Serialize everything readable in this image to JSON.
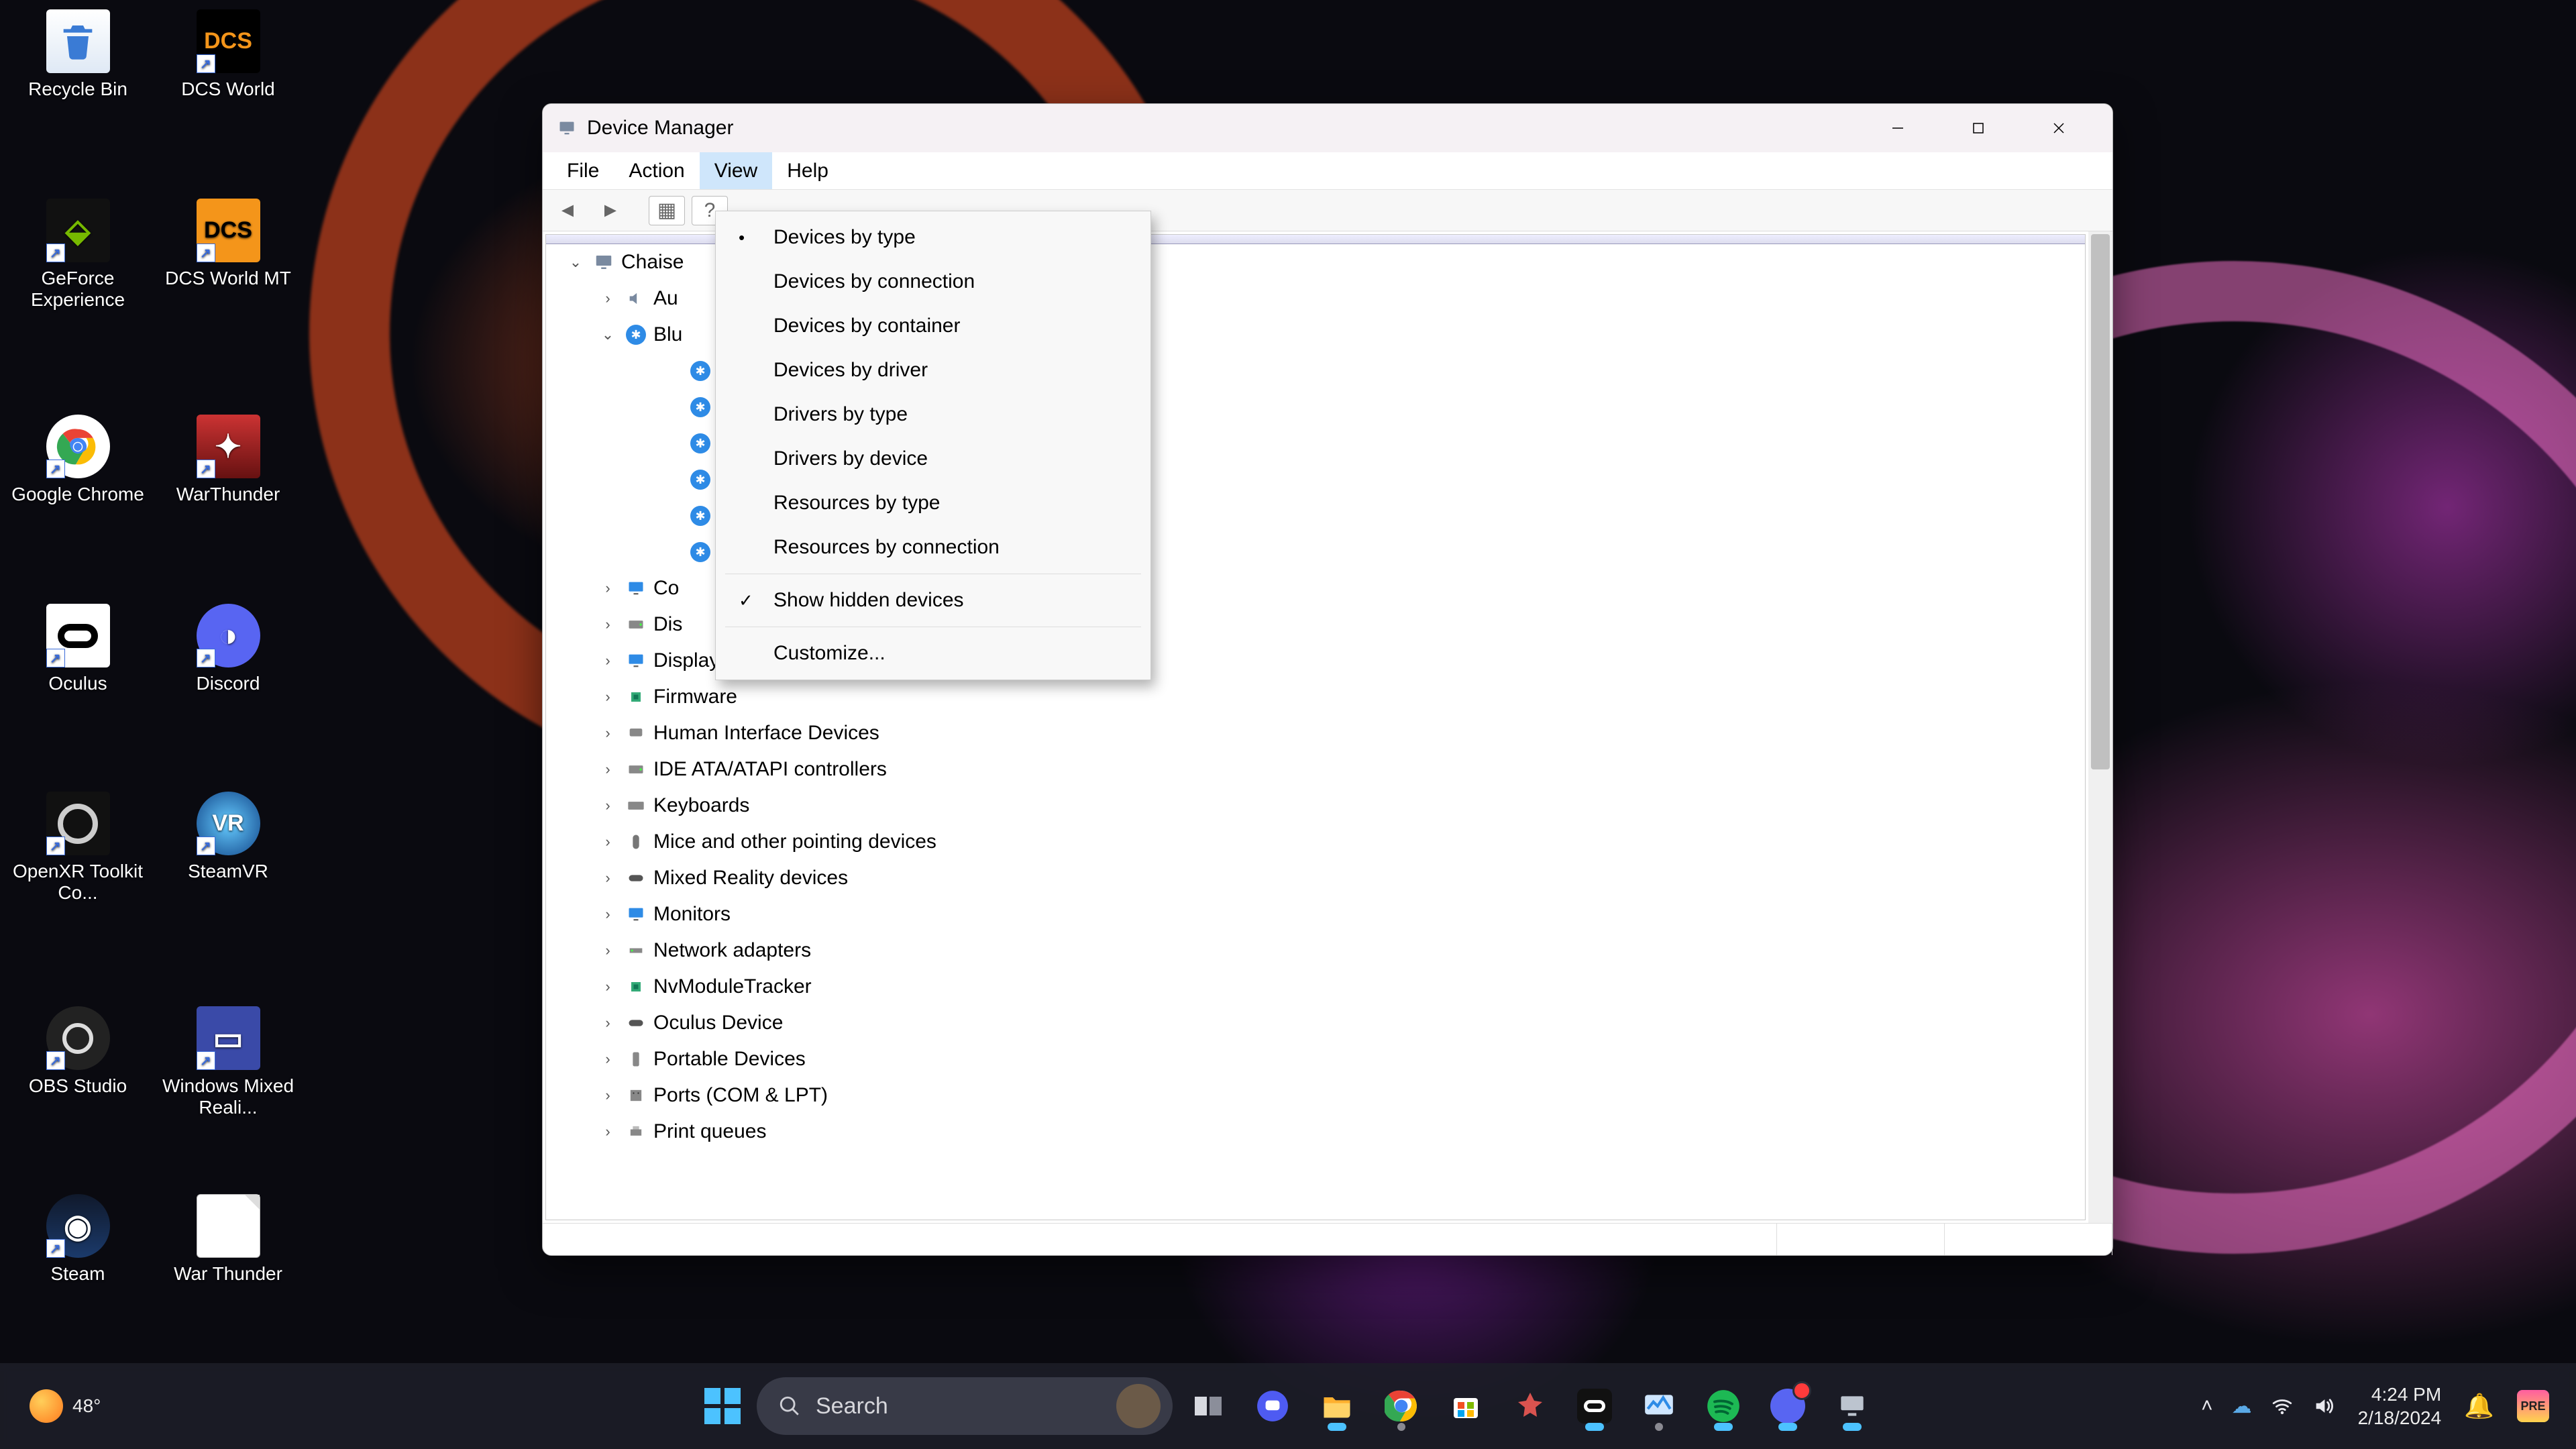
{
  "desktop_icons": [
    {
      "id": "recycle-bin",
      "label": "Recycle Bin"
    },
    {
      "id": "dcs-world",
      "label": "DCS World"
    },
    {
      "id": "geforce-experience",
      "label": "GeForce Experience"
    },
    {
      "id": "dcs-world-mt",
      "label": "DCS World MT"
    },
    {
      "id": "google-chrome",
      "label": "Google Chrome"
    },
    {
      "id": "warthunder",
      "label": "WarThunder"
    },
    {
      "id": "oculus",
      "label": "Oculus"
    },
    {
      "id": "discord",
      "label": "Discord"
    },
    {
      "id": "openxr-toolkit",
      "label": "OpenXR Toolkit Co..."
    },
    {
      "id": "steamvr",
      "label": "SteamVR"
    },
    {
      "id": "obs-studio",
      "label": "OBS Studio"
    },
    {
      "id": "windows-mixed-reality",
      "label": "Windows Mixed Reali..."
    },
    {
      "id": "steam",
      "label": "Steam"
    },
    {
      "id": "war-thunder-file",
      "label": "War Thunder"
    }
  ],
  "window": {
    "title": "Device Manager",
    "menus": [
      "File",
      "Action",
      "View",
      "Help"
    ],
    "active_menu_index": 2,
    "root_label": "Chaise",
    "tree": [
      {
        "label": "Au",
        "partial": true
      },
      {
        "label": "Blu",
        "partial": true,
        "expanded": true,
        "icon": "bluetooth",
        "children_count": 6
      },
      {
        "label": "Co",
        "partial": true
      },
      {
        "label": "Dis",
        "partial": true
      },
      {
        "label": "Display adapters"
      },
      {
        "label": "Firmware"
      },
      {
        "label": "Human Interface Devices"
      },
      {
        "label": "IDE ATA/ATAPI controllers"
      },
      {
        "label": "Keyboards"
      },
      {
        "label": "Mice and other pointing devices"
      },
      {
        "label": "Mixed Reality devices"
      },
      {
        "label": "Monitors"
      },
      {
        "label": "Network adapters"
      },
      {
        "label": "NvModuleTracker"
      },
      {
        "label": "Oculus Device"
      },
      {
        "label": "Portable Devices"
      },
      {
        "label": "Ports (COM & LPT)"
      },
      {
        "label": "Print queues"
      }
    ]
  },
  "view_menu": {
    "items": [
      {
        "label": "Devices by type",
        "mark": "•"
      },
      {
        "label": "Devices by connection"
      },
      {
        "label": "Devices by container"
      },
      {
        "label": "Devices by driver"
      },
      {
        "label": "Drivers by type"
      },
      {
        "label": "Drivers by device"
      },
      {
        "label": "Resources by type"
      },
      {
        "label": "Resources by connection"
      },
      {
        "sep": true
      },
      {
        "label": "Show hidden devices",
        "mark": "✓"
      },
      {
        "sep": true
      },
      {
        "label": "Customize..."
      }
    ]
  },
  "taskbar": {
    "weather_temp": "48°",
    "search_placeholder": "Search",
    "time": "4:24 PM",
    "date": "2/18/2024"
  }
}
